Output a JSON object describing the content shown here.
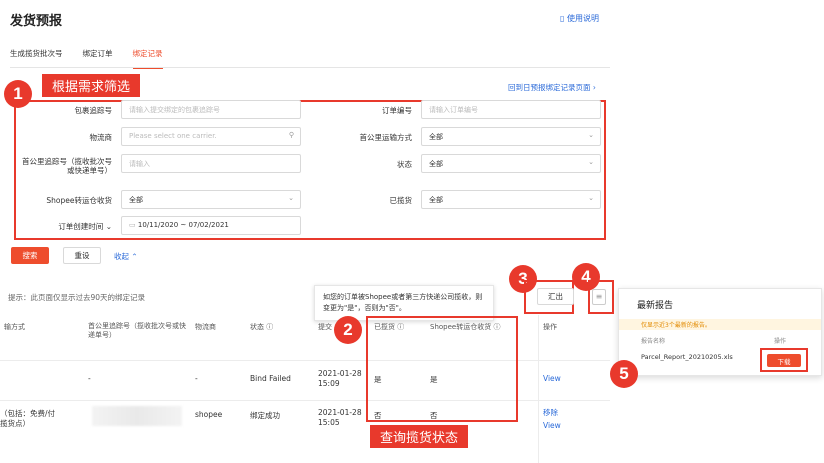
{
  "page": {
    "title": "发货预报",
    "help_link": "使用说明"
  },
  "tabs": [
    "生成揽货批次号",
    "绑定订单",
    "绑定记录"
  ],
  "annotations": {
    "n1": "1",
    "n1_tag": "根据需求筛选",
    "n2": "2",
    "n2_tag": "查询揽货状态",
    "n3": "3",
    "n4": "4",
    "n5": "5"
  },
  "filter": {
    "return_link": "回到日预报绑定记录页面 ›",
    "fields": {
      "parcel_no": {
        "label": "包裹追踪号",
        "placeholder": "请输入提交绑定的包裹追踪号"
      },
      "order_no": {
        "label": "订单编号",
        "placeholder": "请输入订单编号"
      },
      "carrier": {
        "label": "物流商",
        "placeholder": "Please select one carrier."
      },
      "first_mile_method": {
        "label": "首公里运输方式",
        "value": "全部"
      },
      "first_mile_no": {
        "label": "首公里追踪号（揽收批次号或快递单号）",
        "placeholder": "请输入"
      },
      "status": {
        "label": "状态",
        "value": "全部"
      },
      "shopee_transfer": {
        "label": "Shopee转运仓收货",
        "value": "全部"
      },
      "picked_up": {
        "label": "已揽货",
        "value": "全部"
      },
      "created_time": {
        "label": "订单创建时间",
        "value": "10/11/2020 ~ 07/02/2021"
      }
    },
    "search_btn": "搜索",
    "reset_btn": "重设",
    "collapse": "收起"
  },
  "list": {
    "hint": "提示：此页面仅显示过去90天的绑定记录",
    "tooltip": "如您的订单被Shopee或者第三方快递公司揽收，则变更为\"是\"，否则为\"否\"。",
    "export_btn": "汇出",
    "columns": [
      "输方式",
      "首公里追踪号（揽收批次号或快递单号）",
      "物流商",
      "状态",
      "提交",
      "已揽货",
      "Shopee转运仓收货",
      "操作"
    ],
    "rows": [
      {
        "method": "",
        "tracking": "-",
        "carrier": "-",
        "status": "Bind Failed",
        "date": "2021-01-28",
        "time": "15:09",
        "picked": "是",
        "received": "是",
        "actions": [
          "View"
        ]
      },
      {
        "method": "（包括：免费/付",
        "method2": "揽货点）",
        "tracking": "",
        "carrier": "shopee",
        "status": "绑定成功",
        "date": "2021-01-28",
        "time": "15:05",
        "picked": "否",
        "received": "否",
        "actions": [
          "移除",
          "View"
        ]
      }
    ]
  },
  "report": {
    "title": "最新报告",
    "notice": "仅显示近3个最新的报告。",
    "col_name": "报告名称",
    "col_action": "操作",
    "file": "Parcel_Report_20210205.xls",
    "download": "下载"
  },
  "colors": {
    "accent": "#ee4d2d",
    "annotation": "#e8392c",
    "link": "#2c6bd9"
  }
}
